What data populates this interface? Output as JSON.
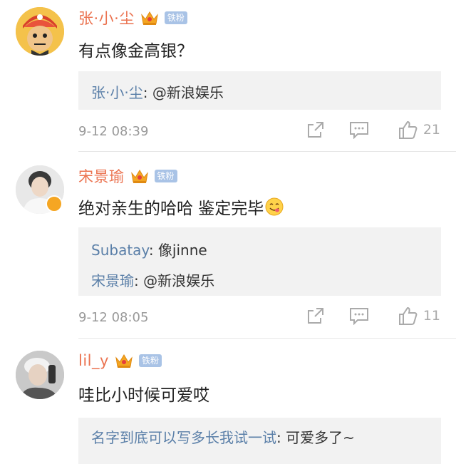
{
  "comments": [
    {
      "user": "张·小·尘",
      "fan_badge": "铁粉",
      "text": "有点像金高银？",
      "replies": [
        {
          "name": "张·小·尘",
          "text": ": @新浪娱乐"
        }
      ],
      "time": "9-12 08:39",
      "likes": "21"
    },
    {
      "user": "宋景瑜",
      "fan_badge": "铁粉",
      "text": "绝对亲生的哈哈 鉴定完毕",
      "replies": [
        {
          "name": "Subatay",
          "text": ": 像jinne"
        },
        {
          "name": "宋景瑜",
          "text": ": @新浪娱乐"
        }
      ],
      "time": "9-12 08:05",
      "likes": "11"
    },
    {
      "user": "lil_y",
      "fan_badge": "铁粉",
      "text": "哇比小时候可爱哎",
      "replies": [
        {
          "name": "名字到底可以写多长我试一试",
          "text": ": 可爱多了~"
        }
      ]
    }
  ],
  "icons": {
    "share": "share-icon",
    "comment": "comment-icon",
    "like": "thumbs-up-icon",
    "crown": "crown-icon",
    "emoji": "yum-face-emoji"
  },
  "colors": {
    "username": "#eb7350",
    "reply_name": "#5a7fa8",
    "fan_badge": "#a9c3e6",
    "reply_bg": "#f2f2f2"
  }
}
